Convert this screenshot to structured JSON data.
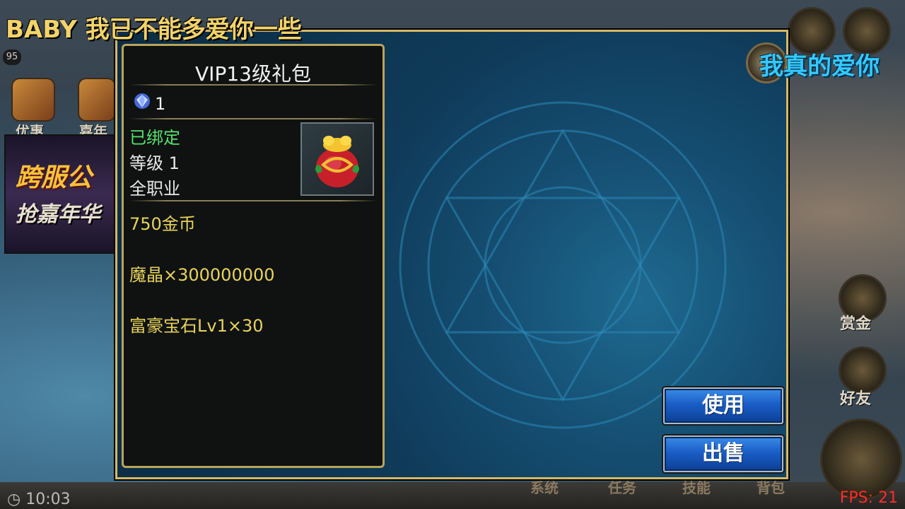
{
  "subtitles": {
    "left": "BABY 我已不能多爱你一些",
    "right": "我真的爱你"
  },
  "hud": {
    "player_level": "95",
    "left_icons": [
      "优惠",
      "嘉年"
    ],
    "banner_line1": "跨服公",
    "banner_line2": "抢嘉年华",
    "clock": "10:03",
    "bottom_tabs": [
      "系统",
      "任务",
      "技能",
      "背包"
    ],
    "right_labels": [
      "赏金",
      "好友"
    ],
    "fps": "FPS: 21"
  },
  "tooltip": {
    "title": "VIP13级礼包",
    "gem_icon": "blue-diamond-icon",
    "gem_count": "1",
    "bound_status": "已绑定",
    "level_req": "等级 1",
    "class_req": "全职业",
    "item_icon": "red-gift-bag-icon",
    "rewards": [
      "750金币",
      "魔晶×300000000",
      "富豪宝石Lv1×30"
    ]
  },
  "actions": {
    "use_label": "使用",
    "sell_label": "出售"
  },
  "colors": {
    "frame_gold": "#d6b866",
    "bound_green": "#55e070",
    "reward_yellow": "#e9d35e",
    "button_blue": "#1a5ec8",
    "fps_red": "#ff2b2b"
  }
}
